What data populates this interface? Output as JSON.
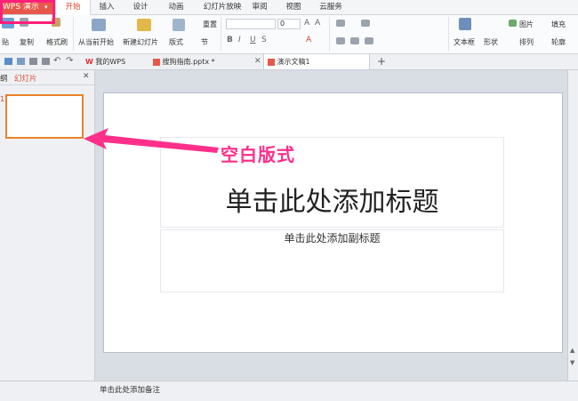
{
  "app": {
    "button_label": "WPS 演示",
    "dropdown": "▾"
  },
  "menu_tabs": [
    "开始",
    "插入",
    "设计",
    "动画",
    "幻灯片放映",
    "审阅",
    "视图",
    "云服务"
  ],
  "ribbon": {
    "paste": "贴",
    "copy": "复制",
    "format_painter": "格式刷",
    "from_current": "从当前开始",
    "new_slide": "新建幻灯片",
    "layout": "版式",
    "section": "节",
    "reset": "重置",
    "font_size": "0",
    "textbox": "文本框",
    "shape": "形状",
    "picture": "图片",
    "fill": "填充",
    "arrange": "排列",
    "outline": "轮廓"
  },
  "doc_tabs": [
    "我的WPS",
    "搜狗指南.pptx *",
    "演示文稿1"
  ],
  "left_panel": {
    "outline_tab": "纲",
    "slides_tab": "幻灯片",
    "slide_number": "1"
  },
  "slide": {
    "title": "单击此处添加标题",
    "subtitle": "单击此处添加副标题"
  },
  "notes_placeholder": "单击此处添加备注",
  "annotation": {
    "label": "空白版式",
    "color": "#ff2f8a"
  },
  "colors": {
    "accent": "#e8584a",
    "thumb_border": "#e8832a"
  }
}
